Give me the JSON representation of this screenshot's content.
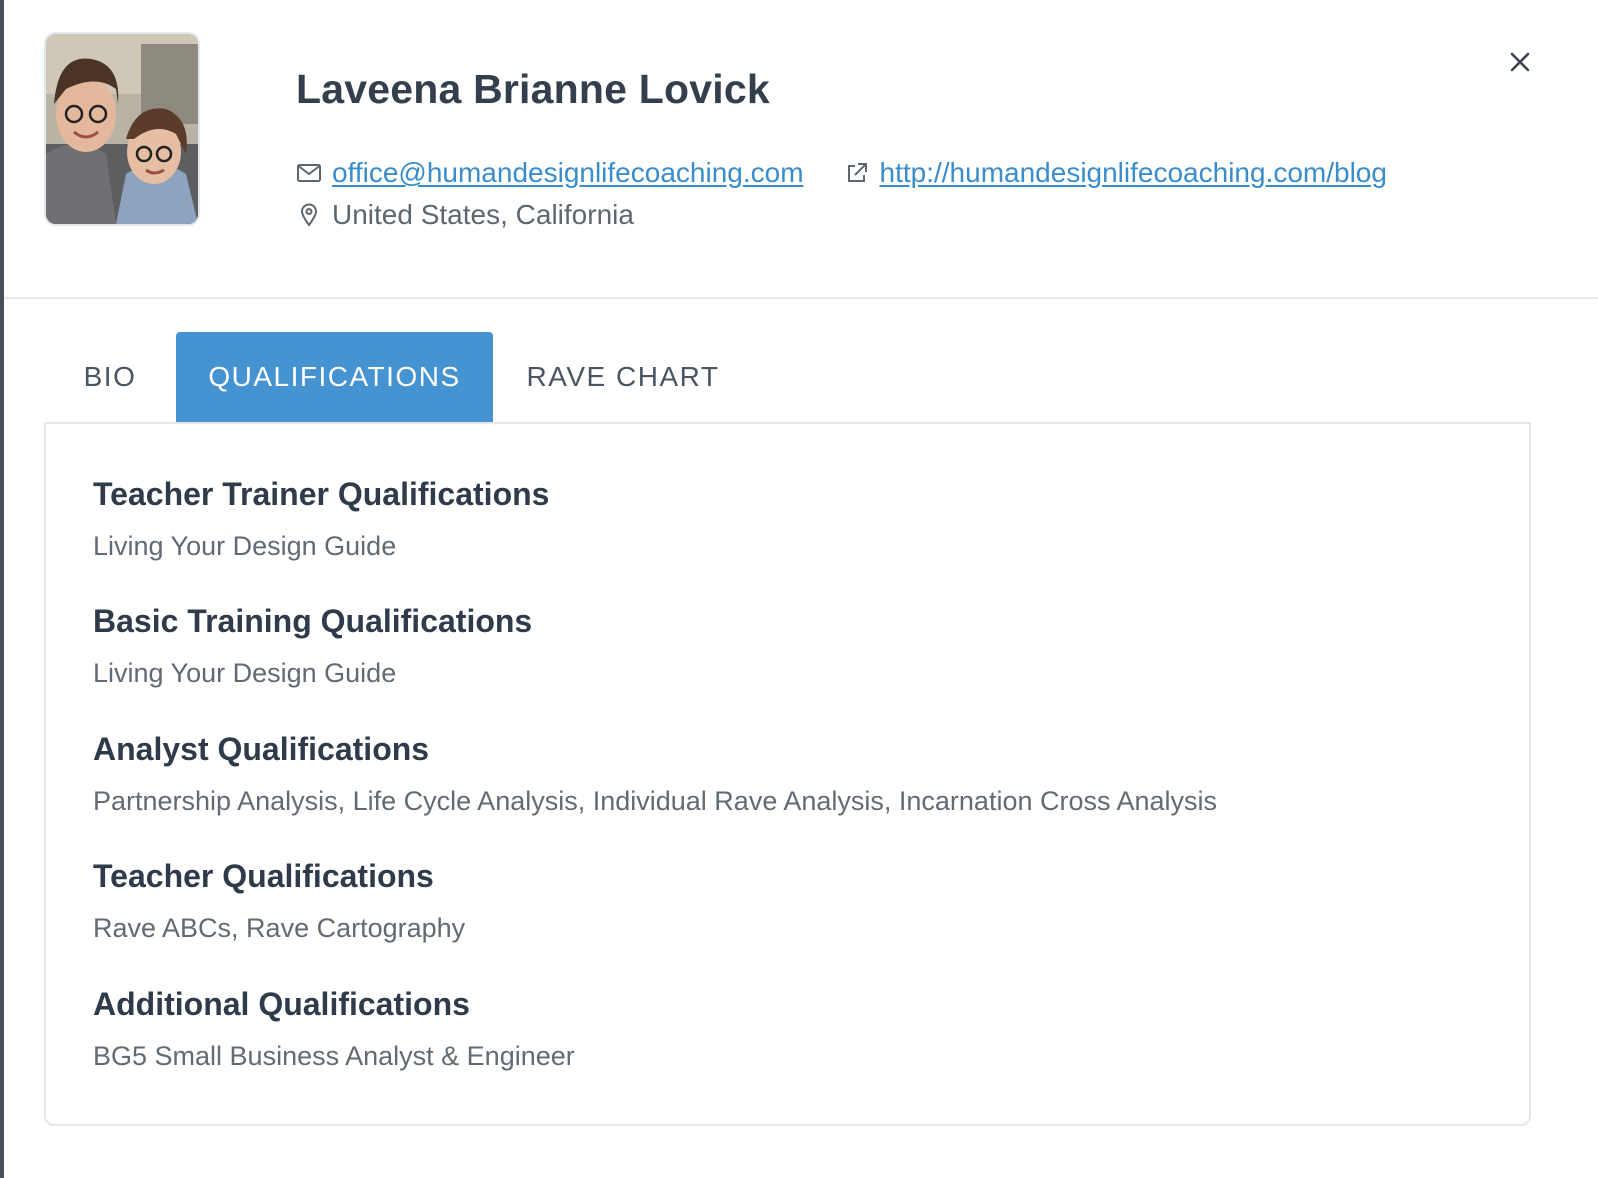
{
  "profile": {
    "name": "Laveena Brianne Lovick",
    "email": "office@humandesignlifecoaching.com",
    "website": "http://humandesignlifecoaching.com/blog",
    "location": "United States, California"
  },
  "icons": {
    "email": "envelope-icon",
    "website": "external-link-icon",
    "location": "map-pin-icon",
    "close": "close-icon"
  },
  "tabs": [
    {
      "label": "BIO",
      "active": false
    },
    {
      "label": "QUALIFICATIONS",
      "active": true
    },
    {
      "label": "RAVE CHART",
      "active": false
    }
  ],
  "qualifications": [
    {
      "title": "Teacher Trainer Qualifications",
      "value": "Living Your Design Guide"
    },
    {
      "title": "Basic Training Qualifications",
      "value": "Living Your Design Guide"
    },
    {
      "title": "Analyst Qualifications",
      "value": "Partnership Analysis, Life Cycle Analysis, Individual Rave Analysis, Incarnation Cross Analysis"
    },
    {
      "title": "Teacher Qualifications",
      "value": "Rave ABCs, Rave Cartography"
    },
    {
      "title": "Additional Qualifications",
      "value": "BG5 Small Business Analyst & Engineer"
    }
  ],
  "colors": {
    "accent": "#4593d0",
    "link": "#3a8dcc",
    "heading": "#2f3b4a",
    "muted": "#626a73"
  }
}
